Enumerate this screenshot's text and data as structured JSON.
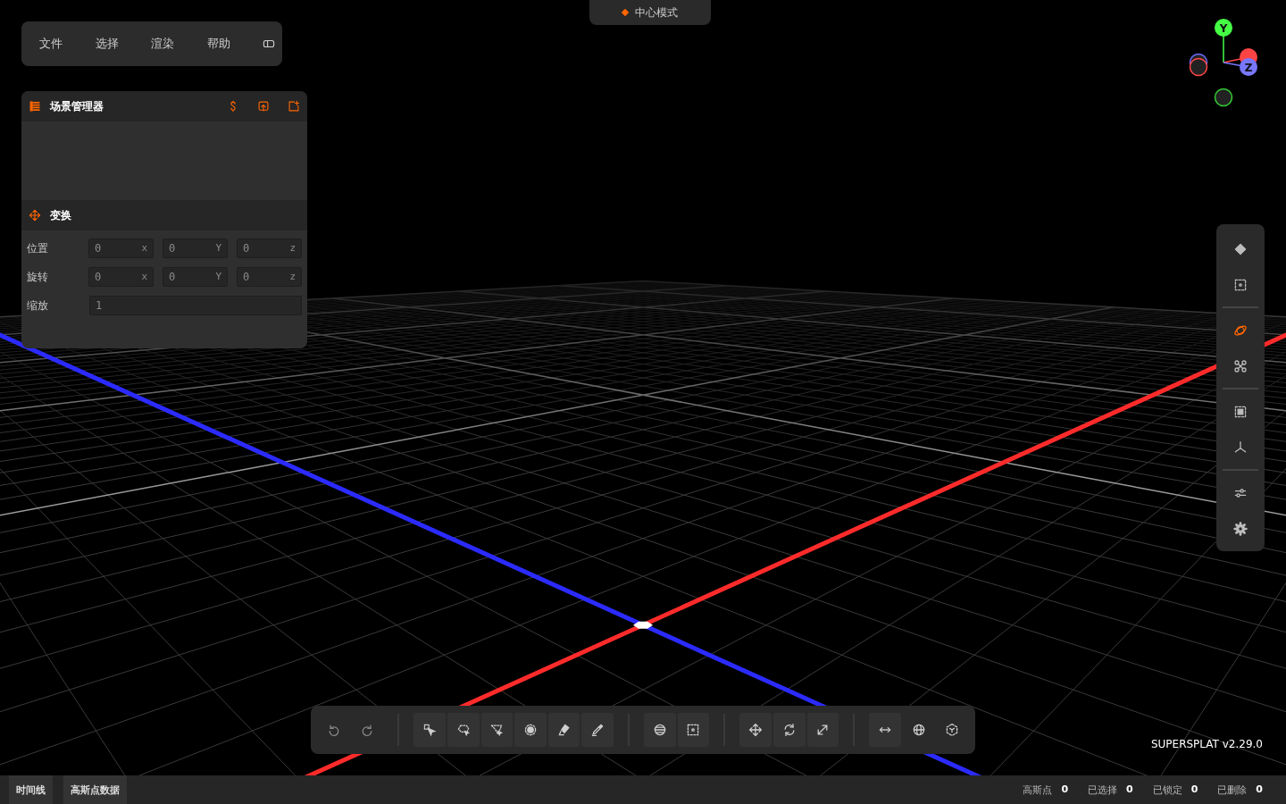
{
  "menu_bar": {
    "items": [
      "文件",
      "选择",
      "渲染",
      "帮助"
    ]
  },
  "mode_badge": {
    "label": "中心模式"
  },
  "scene_manager": {
    "title": "场景管理器"
  },
  "transform": {
    "title": "变换",
    "rows": [
      {
        "label": "位置",
        "kind": "vector",
        "fields": [
          {
            "value": "0",
            "axis": "x"
          },
          {
            "value": "0",
            "axis": "Y"
          },
          {
            "value": "0",
            "axis": "z"
          }
        ]
      },
      {
        "label": "旋转",
        "kind": "vector",
        "fields": [
          {
            "value": "0",
            "axis": "x"
          },
          {
            "value": "0",
            "axis": "Y"
          },
          {
            "value": "0",
            "axis": "z"
          }
        ]
      },
      {
        "label": "缩放",
        "kind": "scalar",
        "fields": [
          {
            "value": "1"
          }
        ]
      }
    ]
  },
  "gizmo": {
    "y_label": "Y",
    "z_label": "Z"
  },
  "right_toolbar": {
    "camera_modes": [
      {
        "selected": true
      },
      {
        "selected": false
      }
    ]
  },
  "bottom_toolbar": {
    "undo": {
      "disabled": true
    },
    "redo": {
      "disabled": true
    }
  },
  "version": "SUPERSPLAT v2.29.0",
  "status_bar": {
    "tabs": [
      "时间线",
      "高斯点数据"
    ],
    "stats": [
      {
        "label": "高斯点",
        "value": "0"
      },
      {
        "label": "已选择",
        "value": "0"
      },
      {
        "label": "已锁定",
        "value": "0"
      },
      {
        "label": "已删除",
        "value": "0"
      }
    ]
  }
}
